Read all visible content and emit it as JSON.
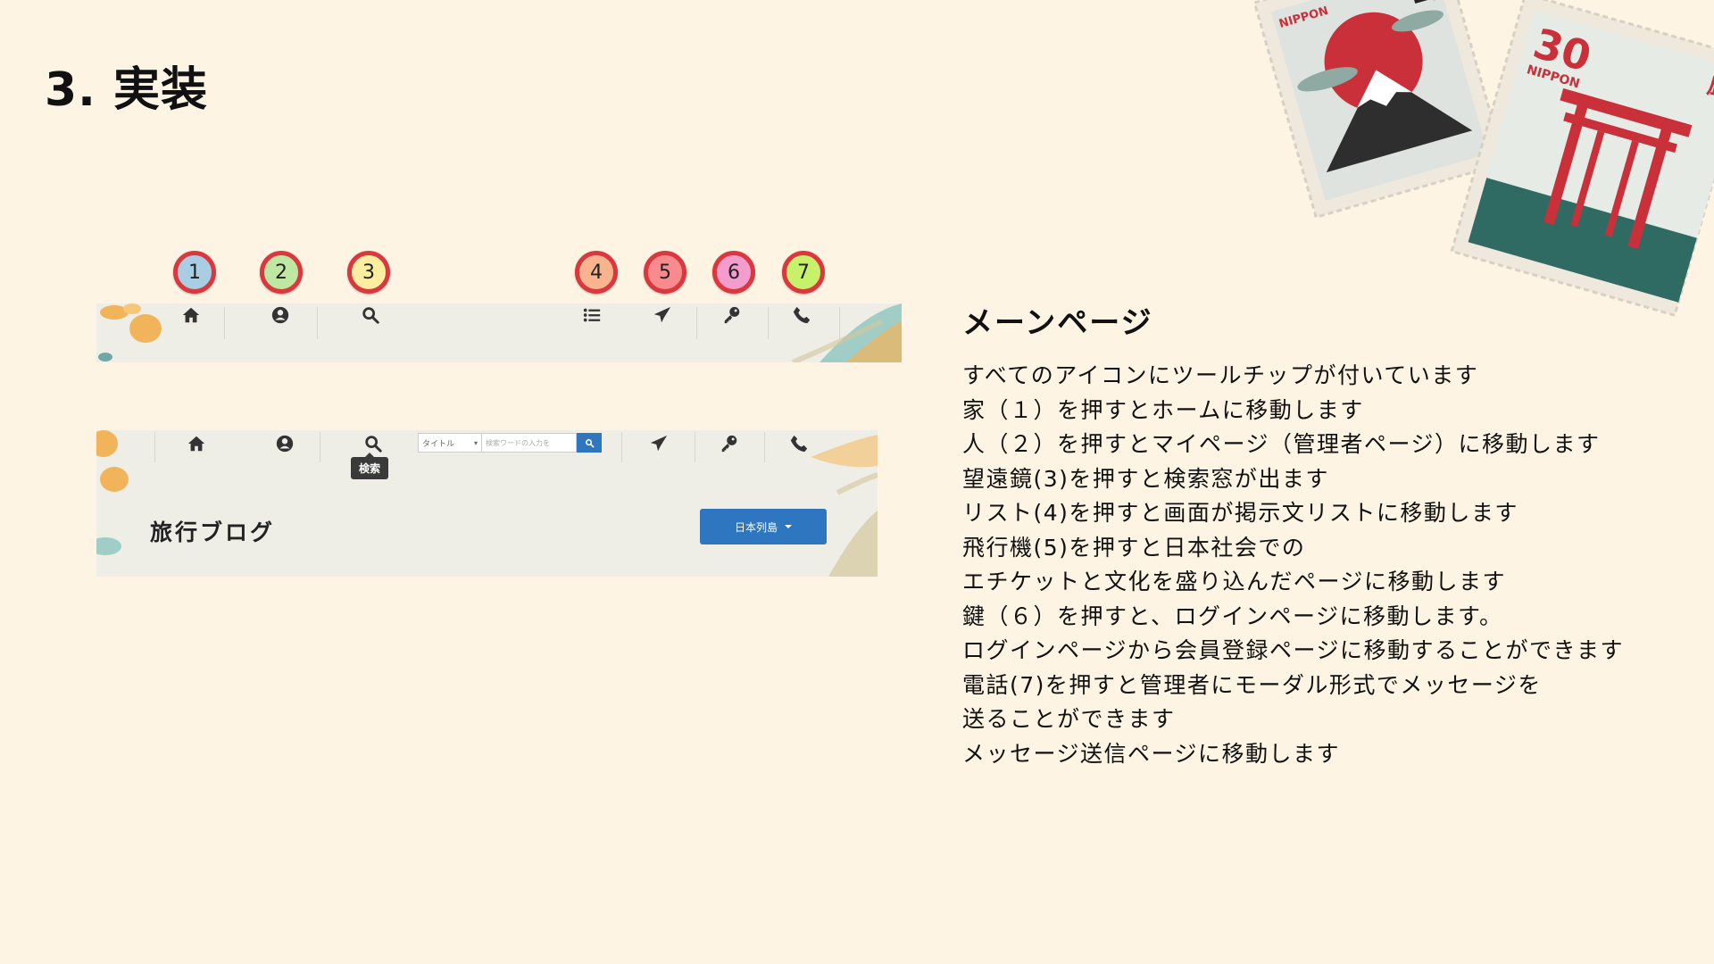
{
  "slide": {
    "title": "3. 実装"
  },
  "markers": [
    "1",
    "2",
    "3",
    "4",
    "5",
    "6",
    "7"
  ],
  "marker_colors": [
    "#a9cde3",
    "#bfe7a4",
    "#fbeea0",
    "#f7b48f",
    "#f98a8e",
    "#f39ccd",
    "#c7f06b"
  ],
  "navbar2": {
    "search": {
      "select": "タイトル",
      "placeholder": "検索ワードの入力を"
    },
    "tooltip": "検索",
    "blog_title": "旅行ブログ",
    "region_button": "日本列島"
  },
  "stamps": {
    "top_text": "NIPPON",
    "top_kanji": "山",
    "value": "30",
    "bottom_text": "NIPPON",
    "bottom_kanji": "厳"
  },
  "side": {
    "heading": "メーンページ",
    "lines": [
      "すべてのアイコンにツールチップが付いています",
      "家（１）を押すとホームに移動します",
      "人（２）を押すとマイページ（管理者ページ）に移動します",
      "望遠鏡(3)を押すと検索窓が出ます",
      "リスト(4)を押すと画面が掲示文リストに移動します",
      "飛行機(5)を押すと日本社会での",
      "エチケットと文化を盛り込んだページに移動します",
      "鍵（６）を押すと、ログインページに移動します。",
      "ログインページから会員登録ページに移動することができます",
      "電話(7)を押すと管理者にモーダル形式でメッセージを",
      "送ることができます",
      "メッセージ送信ページに移動します"
    ]
  },
  "colors": {
    "background": "#fdf4e3",
    "navbar": "#eeeee6",
    "accent_blue": "#2f76c0",
    "marker_ring": "#d9393e"
  }
}
